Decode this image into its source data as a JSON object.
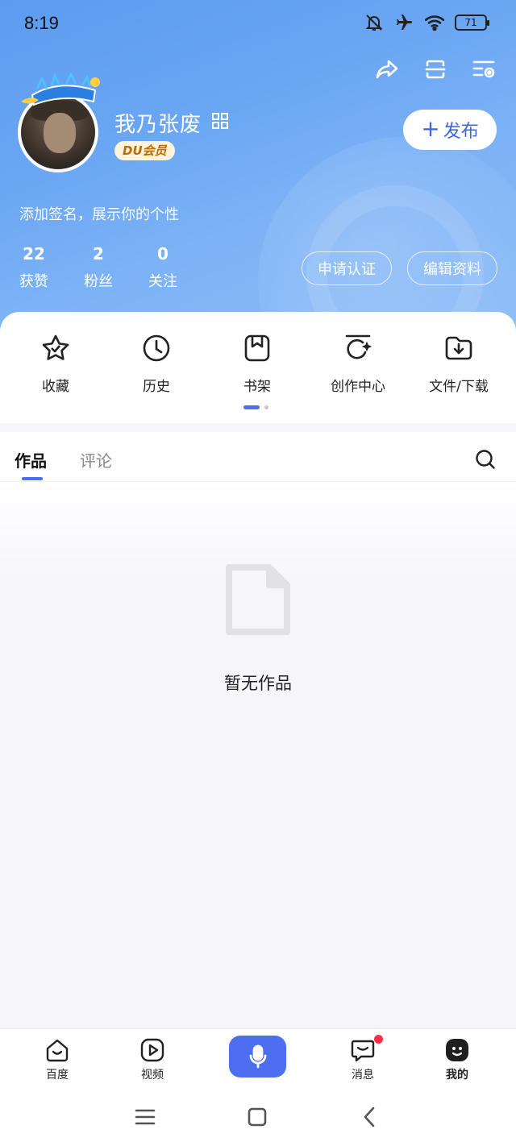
{
  "status_bar": {
    "time": "8:19",
    "battery": "71"
  },
  "profile": {
    "username": "我乃张废",
    "vip_badge": "DU会员",
    "signature": "添加签名，展示你的个性",
    "publish_label": "发布",
    "stats": [
      {
        "num": "22",
        "label": "获赞"
      },
      {
        "num": "2",
        "label": "粉丝"
      },
      {
        "num": "0",
        "label": "关注"
      }
    ],
    "apply_cert_label": "申请认证",
    "edit_profile_label": "编辑资料"
  },
  "shortcuts": [
    {
      "label": "收藏",
      "icon": "star-icon"
    },
    {
      "label": "历史",
      "icon": "clock-icon"
    },
    {
      "label": "书架",
      "icon": "bookmark-icon"
    },
    {
      "label": "创作中心",
      "icon": "create-icon"
    },
    {
      "label": "文件/下载",
      "icon": "folder-download-icon"
    }
  ],
  "tabs": [
    {
      "label": "作品",
      "active": true
    },
    {
      "label": "评论",
      "active": false
    }
  ],
  "empty_state": {
    "text": "暂无作品"
  },
  "bottom_nav": [
    {
      "label": "百度",
      "icon": "baidu-home-icon"
    },
    {
      "label": "视频",
      "icon": "video-play-icon"
    },
    {
      "label": "消息",
      "icon": "message-icon"
    },
    {
      "label": "我的",
      "icon": "mine-face-icon"
    }
  ],
  "colors": {
    "accent": "#4e6ef2",
    "hero": "#6aa6f3",
    "notification_dot": "#ff2e4d",
    "vip_text": "#b86e00"
  }
}
